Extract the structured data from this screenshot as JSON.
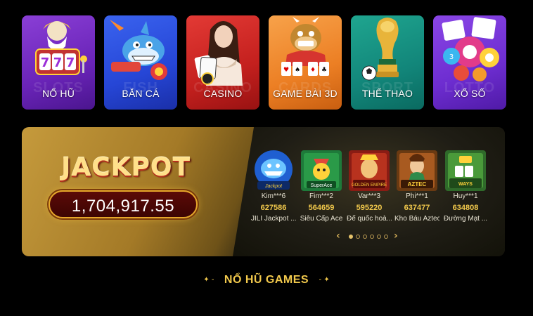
{
  "categories": [
    {
      "label": "NỔ HŨ",
      "watermark": "SLOTS",
      "icon": "slot-machine-icon"
    },
    {
      "label": "BẮN CÁ",
      "watermark": "FISH",
      "icon": "fish-shooter-icon"
    },
    {
      "label": "CASINO",
      "watermark": "CASINO",
      "icon": "casino-dealer-icon"
    },
    {
      "label": "GAME BÀI 3D",
      "watermark": "CARDS",
      "icon": "card-game-icon"
    },
    {
      "label": "THỂ THAO",
      "watermark": "SPORT",
      "icon": "trophy-icon"
    },
    {
      "label": "XỔ SỐ",
      "watermark": "LOTTO",
      "icon": "lottery-balls-icon"
    }
  ],
  "jackpot": {
    "title": "JACKPOT",
    "amount": "1,704,917.55"
  },
  "winners": [
    {
      "user": "Kim***6",
      "score": "627586",
      "game": "JILI Jackpot ...",
      "icon": "jackpot-fishing-icon"
    },
    {
      "user": "Fim***2",
      "score": "564659",
      "game": "Siêu Cấp Ace",
      "icon": "super-ace-icon"
    },
    {
      "user": "Var***3",
      "score": "595220",
      "game": "Đế quốc hoà...",
      "icon": "golden-empire-icon"
    },
    {
      "user": "Phi***1",
      "score": "637477",
      "game": "Kho Báu Aztec",
      "icon": "aztec-icon"
    },
    {
      "user": "Huy***1",
      "score": "634808",
      "game": "Đường Mạt ...",
      "icon": "mahjong-ways-icon"
    }
  ],
  "pager": {
    "total": 6,
    "active": 0,
    "prev": "‹",
    "next": "›"
  },
  "section": {
    "title": "NỔ HŨ GAMES",
    "deco_left": "✦ -",
    "deco_right": "- ✦"
  },
  "colors": {
    "gold": "#f2c94c",
    "background": "#000000"
  }
}
